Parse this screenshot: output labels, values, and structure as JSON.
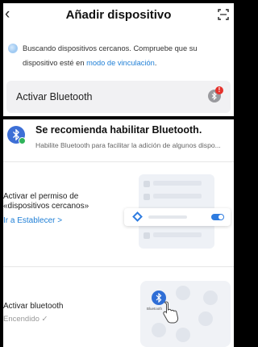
{
  "header": {
    "back_icon": "chevron-left-icon",
    "title": "Añadir dispositivo",
    "scan_icon": "scan-frame-icon"
  },
  "notice": {
    "text": "Buscando dispositivos cercanos. Compruebe que su dispositivo esté en ",
    "link": "modo de vinculación",
    "suffix": "."
  },
  "bluetooth_card": {
    "label": "Activar Bluetooth",
    "icon": "bluetooth-icon",
    "badge": "!"
  },
  "recommendation": {
    "icon": "bluetooth-icon",
    "title": "Se recomienda habilitar Bluetooth.",
    "subtitle": "Habilite Bluetooth para facilitar la adición de algunos dispo..."
  },
  "step_permission": {
    "label": "Activar el permiso de «dispositivos cercanos»",
    "link": "Ir a Establecer >"
  },
  "step_bluetooth": {
    "label": "Activar bluetooth",
    "status": "Encendido ✓",
    "illustration_caption": "Bluetooth"
  },
  "colors": {
    "accent": "#1f7fd6",
    "toggle": "#2f7ce0",
    "badge": "#e5312b",
    "check": "#2fb35a"
  }
}
